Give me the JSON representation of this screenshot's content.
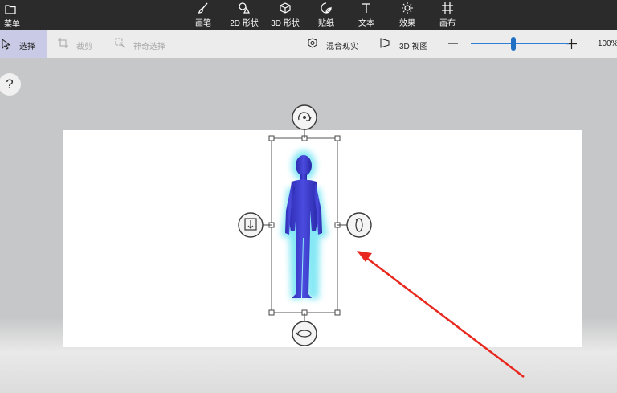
{
  "menu": {
    "label": "菜单",
    "icon": "folder-icon"
  },
  "tools": [
    {
      "label": "画笔",
      "icon": "brush-icon"
    },
    {
      "label": "2D 形状",
      "icon": "2d-shapes-icon"
    },
    {
      "label": "3D 形状",
      "icon": "3d-shapes-icon"
    },
    {
      "label": "贴纸",
      "icon": "sticker-icon"
    },
    {
      "label": "文本",
      "icon": "text-icon"
    },
    {
      "label": "效果",
      "icon": "effects-icon"
    },
    {
      "label": "画布",
      "icon": "canvas-icon"
    }
  ],
  "subbar": {
    "select_label": "选择",
    "crop_label": "裁剪",
    "magic_select_label": "神奇选择",
    "mixed_reality_label": "混合现实",
    "view_3d_label": "3D 视图",
    "zoom_value": "100%"
  },
  "help": {
    "label": "?"
  },
  "colors": {
    "topbar": "#2b2b2b",
    "accent": "#1f6fc4",
    "figure": "#3838c8",
    "glow": "#7fe7f4",
    "arrow": "#e8281e"
  }
}
